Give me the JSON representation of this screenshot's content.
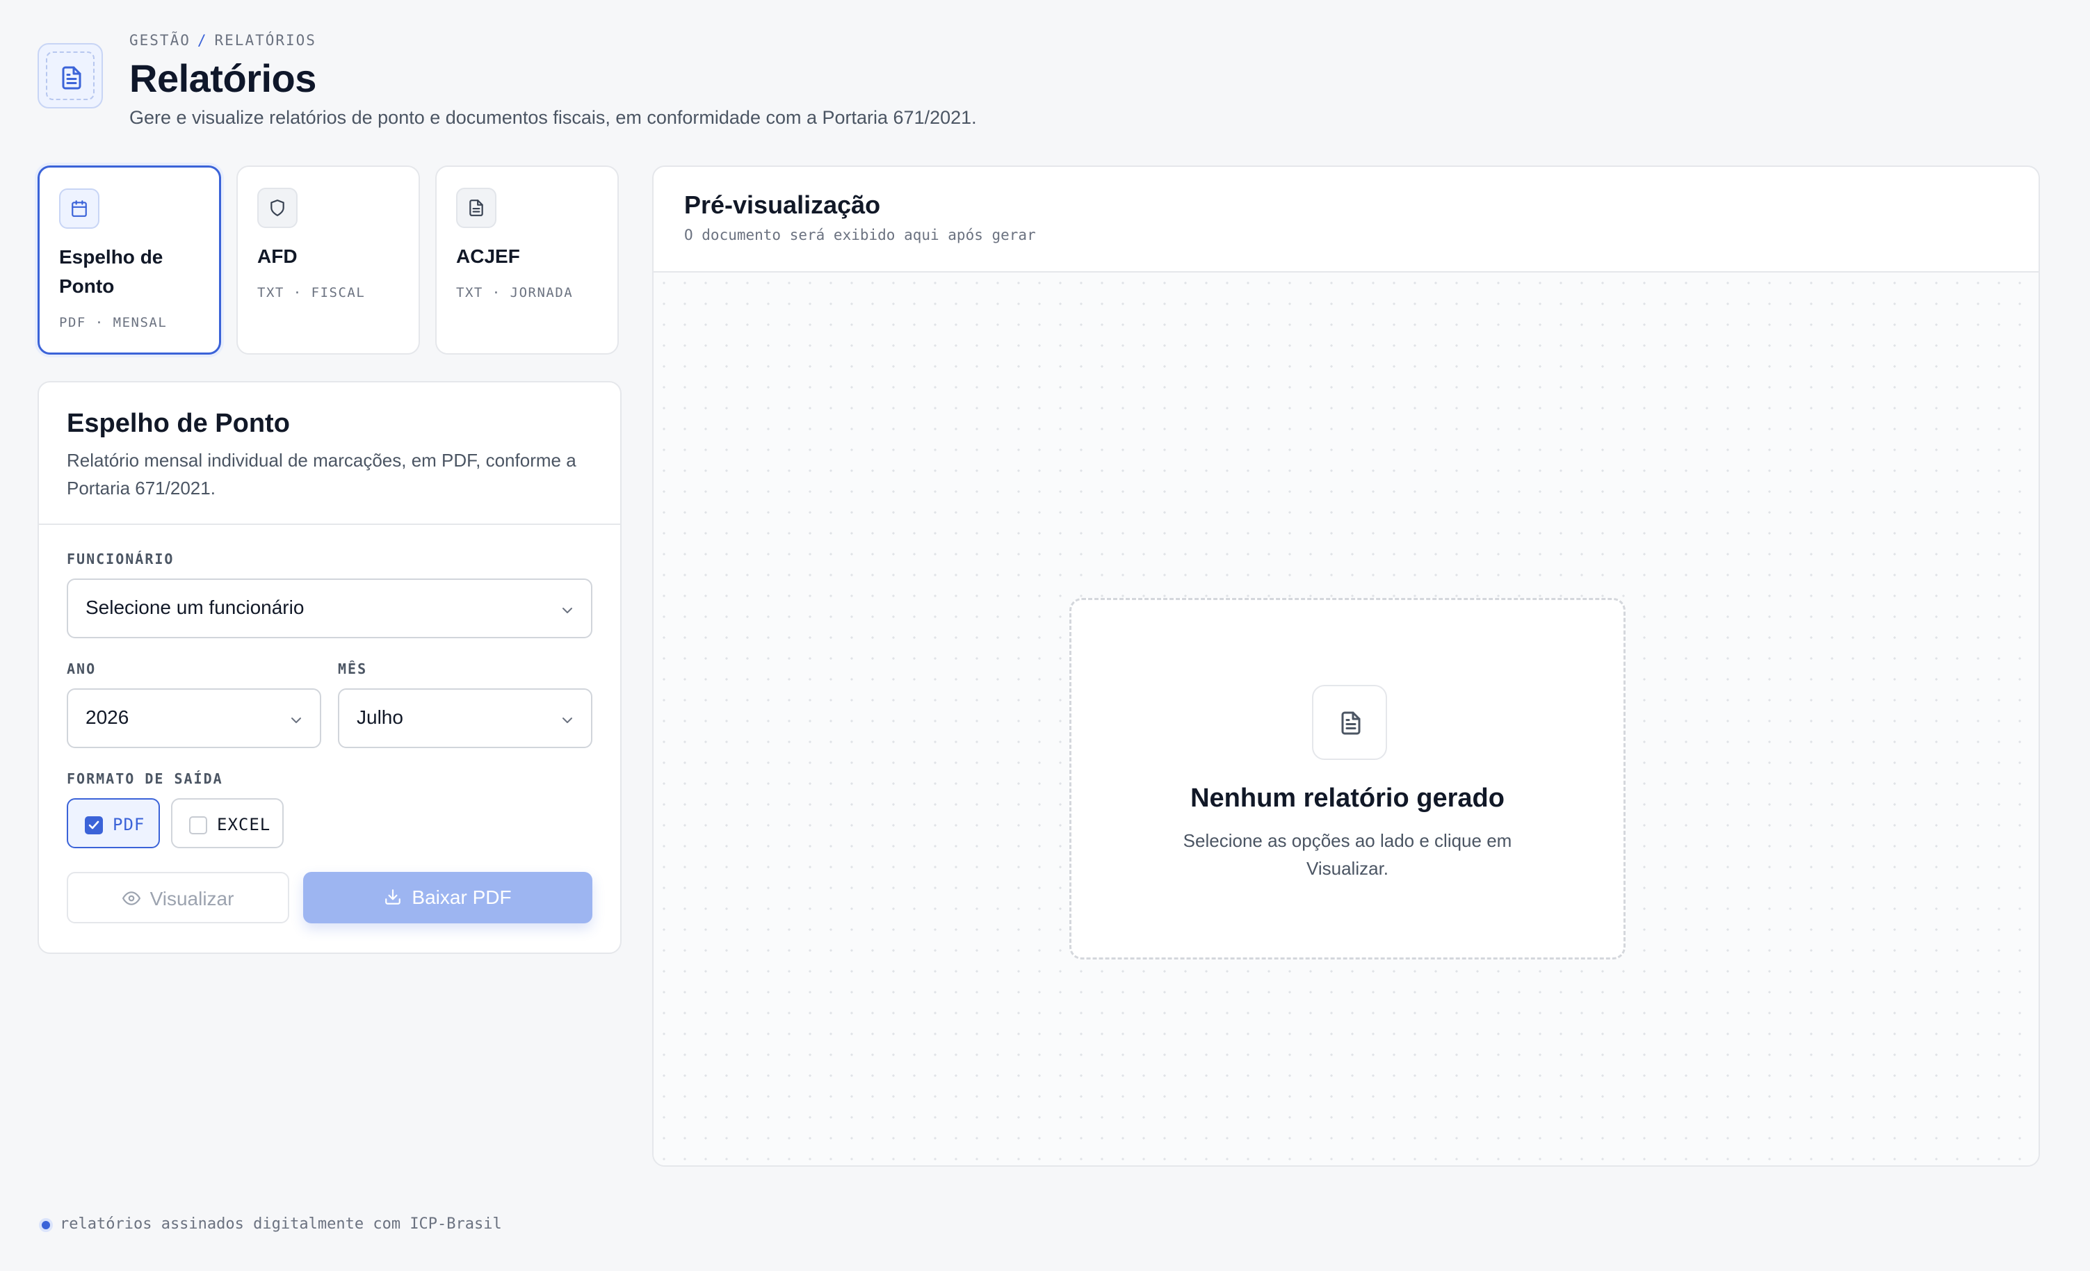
{
  "header": {
    "icon": "file-text-icon",
    "breadcrumb": {
      "parent": "GESTÃO",
      "separator": "/",
      "current": "RELATÓRIOS"
    },
    "title": "Relatórios",
    "subtitle": "Gere e visualize relatórios de ponto e documentos fiscais, em conformidade com a Portaria 671/2021."
  },
  "report_types": [
    {
      "icon": "calendar-icon",
      "title": "Espelho de Ponto",
      "meta": "PDF · MENSAL",
      "selected": true
    },
    {
      "icon": "shield-icon",
      "title": "AFD",
      "meta": "TXT · FISCAL",
      "selected": false
    },
    {
      "icon": "file-text-icon",
      "title": "ACJEF",
      "meta": "TXT · JORNADA",
      "selected": false
    }
  ],
  "form": {
    "title": "Espelho de Ponto",
    "description": "Relatório mensal individual de marcações, em PDF, conforme a Portaria 671/2021.",
    "employee": {
      "label": "FUNCIONÁRIO",
      "value": "Selecione um funcionário"
    },
    "year": {
      "label": "ANO",
      "value": "2026"
    },
    "month": {
      "label": "MÊS",
      "value": "Julho"
    },
    "output_format": {
      "label": "FORMATO DE SAÍDA",
      "options": [
        {
          "label": "PDF",
          "checked": true
        },
        {
          "label": "EXCEL",
          "checked": false
        }
      ]
    },
    "view_button": "Visualizar",
    "download_button": "Baixar PDF"
  },
  "preview": {
    "title": "Pré-visualização",
    "subtitle": "O documento será exibido aqui após gerar",
    "empty_title": "Nenhum relatório gerado",
    "empty_text": "Selecione as opções ao lado e clique em Visualizar."
  },
  "footer": {
    "text": "relatórios assinados digitalmente com ICP-Brasil"
  },
  "colors": {
    "accent": "#3b63d8",
    "accent_light": "#eef3ff",
    "download_button_disabled": "#9db5f1",
    "background": "#f6f7f9"
  }
}
